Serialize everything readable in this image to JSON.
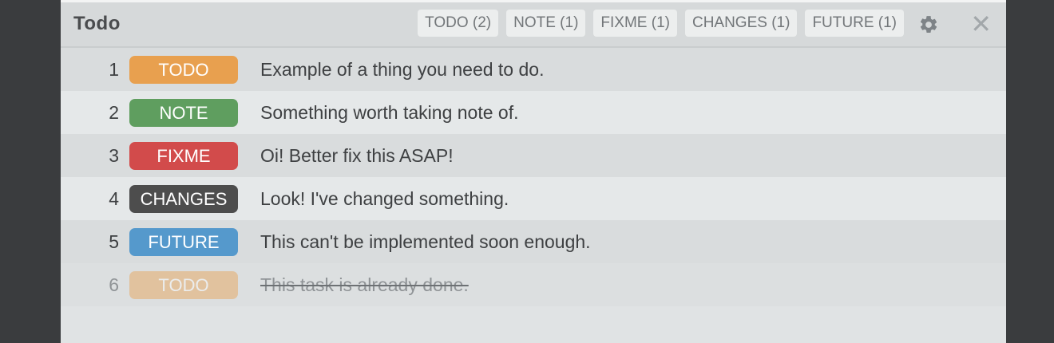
{
  "header": {
    "title": "Todo",
    "filters": [
      {
        "label": "TODO (2)"
      },
      {
        "label": "NOTE (1)"
      },
      {
        "label": "FIXME (1)"
      },
      {
        "label": "CHANGES (1)"
      },
      {
        "label": "FUTURE (1)"
      }
    ],
    "settings_icon": "gear-icon",
    "close_icon": "close-icon",
    "close_glyph": "✕"
  },
  "colors": {
    "TODO": "#e8a04f",
    "NOTE": "#5f9e5f",
    "FIXME": "#d24b4b",
    "CHANGES": "#4d4d4d",
    "FUTURE": "#5599cc"
  },
  "rows": [
    {
      "line": "1",
      "tag": "TODO",
      "text": "Example of a thing you need to do.",
      "done": false
    },
    {
      "line": "2",
      "tag": "NOTE",
      "text": "Something worth taking note of.",
      "done": false
    },
    {
      "line": "3",
      "tag": "FIXME",
      "text": "Oi! Better fix this ASAP!",
      "done": false
    },
    {
      "line": "4",
      "tag": "CHANGES",
      "text": "Look! I've changed something.",
      "done": false
    },
    {
      "line": "5",
      "tag": "FUTURE",
      "text": "This can't be implemented soon enough.",
      "done": false
    },
    {
      "line": "6",
      "tag": "TODO",
      "text": "This task is already done.",
      "done": true
    }
  ]
}
